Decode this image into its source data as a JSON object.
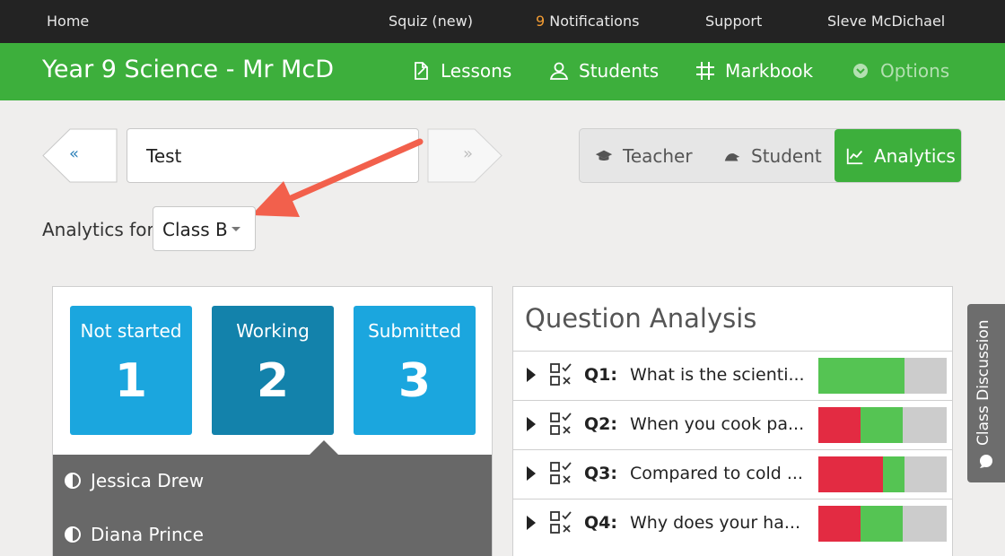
{
  "topbar": {
    "home": "Home",
    "squiz": "Squiz (new)",
    "notifications_count": "9",
    "notifications_label": "Notifications",
    "support": "Support",
    "user": "Sleve McDichael"
  },
  "header": {
    "title": "Year 9 Science - Mr McD",
    "nav": {
      "lessons": "Lessons",
      "students": "Students",
      "markbook": "Markbook",
      "options": "Options"
    },
    "icons": [
      "lessons-icon",
      "students-icon",
      "markbook-grid-icon",
      "options-chevron-icon"
    ]
  },
  "pager": {
    "prev": "«",
    "next": "»",
    "title_value": "Test"
  },
  "roles": {
    "teacher": "Teacher",
    "student": "Student",
    "analytics": "Analytics",
    "active": "analytics"
  },
  "analytics_for": {
    "label": "Analytics for",
    "selected": "Class B"
  },
  "status": {
    "not_started": {
      "label": "Not started",
      "count": "1"
    },
    "working": {
      "label": "Working",
      "count": "2"
    },
    "submitted": {
      "label": "Submitted",
      "count": "3"
    }
  },
  "students": [
    {
      "name": "Jessica Drew"
    },
    {
      "name": "Diana Prince"
    }
  ],
  "question_analysis": {
    "title": "Question Analysis",
    "questions": [
      {
        "num": "Q1:",
        "text": "What is the scienti...",
        "incorrect": 0,
        "correct": 0.67,
        "unanswered": 0.33
      },
      {
        "num": "Q2:",
        "text": "When you cook pa...",
        "incorrect": 0.33,
        "correct": 0.33,
        "unanswered": 0.34
      },
      {
        "num": "Q3:",
        "text": "Compared to cold ...",
        "incorrect": 0.5,
        "correct": 0.17,
        "unanswered": 0.33
      },
      {
        "num": "Q4:",
        "text": "Why does your ha...",
        "incorrect": 0.33,
        "correct": 0.33,
        "unanswered": 0.34
      }
    ]
  },
  "side_tab": {
    "label": "Class Discussion"
  },
  "colors": {
    "brand_green": "#3daf3c",
    "tile_blue": "#1ba6de",
    "tile_blue_dark": "#1382ab",
    "bar_red": "#e32b42",
    "bar_green": "#55c453",
    "bar_grey": "#cccccc",
    "annotation_arrow": "#f2604c"
  }
}
